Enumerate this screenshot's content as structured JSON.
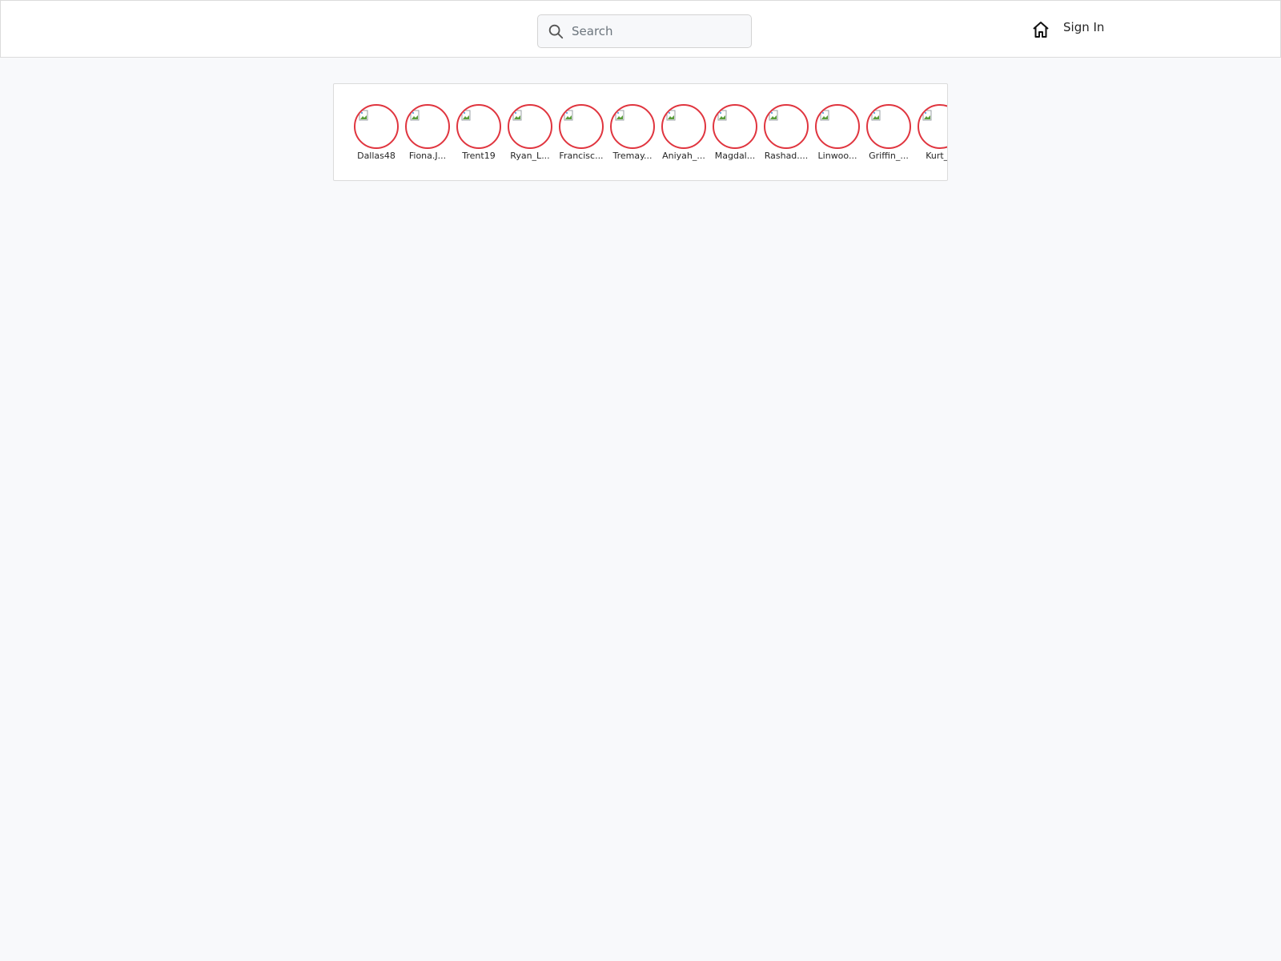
{
  "header": {
    "search": {
      "placeholder": "Search",
      "value": "",
      "icon": "search-icon"
    },
    "home_icon": "home-icon",
    "signin_label": "Sign In"
  },
  "stories": {
    "ring_color": "#e0353f",
    "items": [
      {
        "username": "Dallas48"
      },
      {
        "username": "Fiona.J..."
      },
      {
        "username": "Trent19"
      },
      {
        "username": "Ryan_L..."
      },
      {
        "username": "Francisc..."
      },
      {
        "username": "Tremay..."
      },
      {
        "username": "Aniyah_..."
      },
      {
        "username": "Magdal..."
      },
      {
        "username": "Rashad...."
      },
      {
        "username": "Linwoo..."
      },
      {
        "username": "Griffin_..."
      },
      {
        "username": "Kurt_B"
      }
    ]
  }
}
